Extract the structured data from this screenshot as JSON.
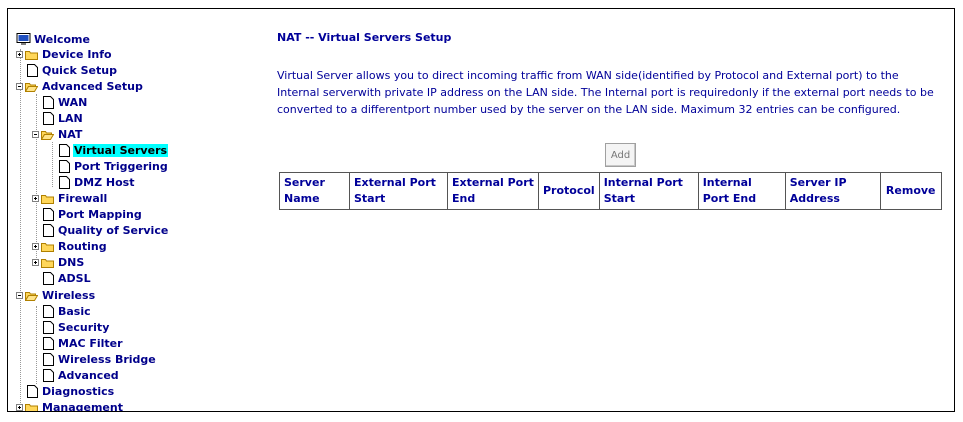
{
  "tree": {
    "welcome": "Welcome",
    "device_info": "Device Info",
    "quick_setup": "Quick Setup",
    "advanced_setup": "Advanced Setup",
    "wan": "WAN",
    "lan": "LAN",
    "nat": "NAT",
    "virtual_servers": "Virtual Servers",
    "port_triggering": "Port Triggering",
    "dmz_host": "DMZ Host",
    "firewall": "Firewall",
    "port_mapping": "Port Mapping",
    "qos": "Quality of Service",
    "routing": "Routing",
    "dns": "DNS",
    "adsl": "ADSL",
    "wireless": "Wireless",
    "basic": "Basic",
    "security": "Security",
    "mac_filter": "MAC Filter",
    "wireless_bridge": "Wireless Bridge",
    "advanced": "Advanced",
    "diagnostics": "Diagnostics",
    "management": "Management"
  },
  "page": {
    "title": "NAT -- Virtual Servers Setup",
    "description": "Virtual Server allows you to direct incoming traffic from WAN side(identified by Protocol and External port) to the Internal serverwith private IP address on the LAN side. The Internal port is requiredonly if the external port needs to be converted to a differentport number used by the server on the LAN side. Maximum 32 entries can be configured.",
    "add_button": "Add"
  },
  "table": {
    "headers": [
      "Server Name",
      "External Port Start",
      "External Port End",
      "Protocol",
      "Internal Port Start",
      "Internal Port End",
      "Server IP Address",
      "Remove"
    ]
  },
  "colors": {
    "link": "#00008b",
    "text": "#000099",
    "selected_bg": "#00ffff",
    "folder": "#ffd75a"
  }
}
